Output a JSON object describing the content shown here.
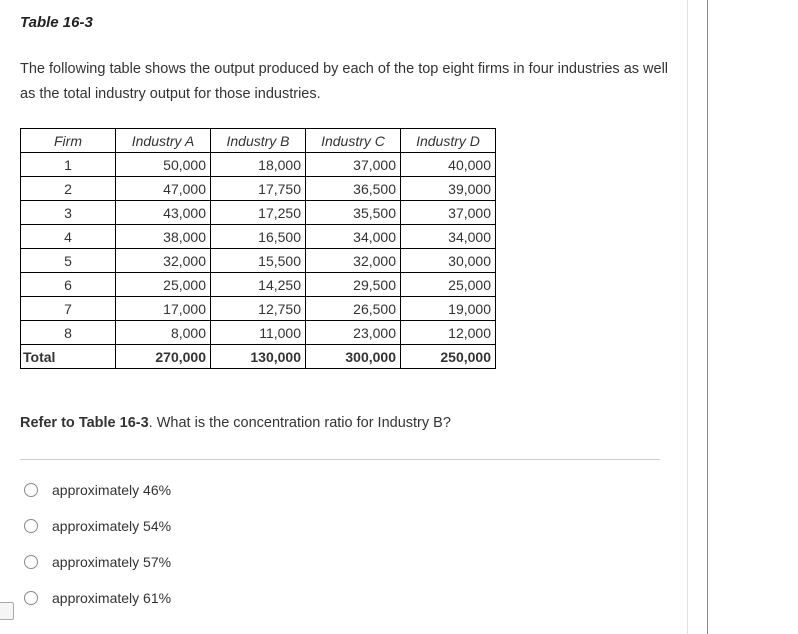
{
  "title": "Table 16-3",
  "description": "The following table shows the output produced by each of the top eight firms in four industries as well as the total industry output for those industries.",
  "table": {
    "headers": [
      "Firm",
      "Industry A",
      "Industry B",
      "Industry C",
      "Industry D"
    ],
    "rows": [
      {
        "firm": "1",
        "values": [
          "50,000",
          "18,000",
          "37,000",
          "40,000"
        ]
      },
      {
        "firm": "2",
        "values": [
          "47,000",
          "17,750",
          "36,500",
          "39,000"
        ]
      },
      {
        "firm": "3",
        "values": [
          "43,000",
          "17,250",
          "35,500",
          "37,000"
        ]
      },
      {
        "firm": "4",
        "values": [
          "38,000",
          "16,500",
          "34,000",
          "34,000"
        ]
      },
      {
        "firm": "5",
        "values": [
          "32,000",
          "15,500",
          "32,000",
          "30,000"
        ]
      },
      {
        "firm": "6",
        "values": [
          "25,000",
          "14,250",
          "29,500",
          "25,000"
        ]
      },
      {
        "firm": "7",
        "values": [
          "17,000",
          "12,750",
          "26,500",
          "19,000"
        ]
      },
      {
        "firm": "8",
        "values": [
          "8,000",
          "11,000",
          "23,000",
          "12,000"
        ]
      }
    ],
    "total": {
      "firm": "Total",
      "values": [
        "270,000",
        "130,000",
        "300,000",
        "250,000"
      ]
    }
  },
  "question": {
    "ref": "Refer to Table 16-3",
    "text": ".  What is the concentration ratio for Industry B?"
  },
  "options": [
    "approximately 46%",
    "approximately 54%",
    "approximately 57%",
    "approximately 61%"
  ]
}
